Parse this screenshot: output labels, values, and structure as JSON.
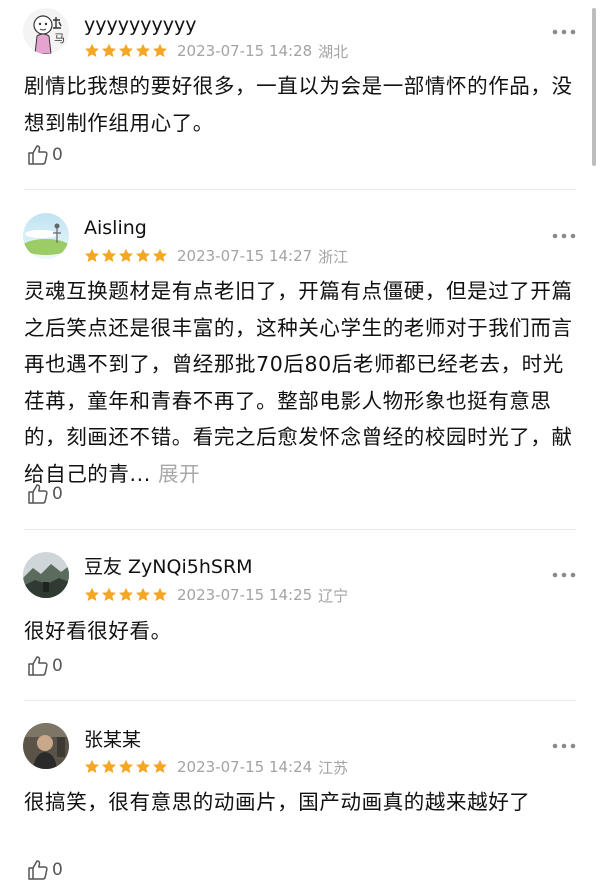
{
  "colors": {
    "star": "#f5a623",
    "meta_text": "#a3a3a3",
    "expand_text": "#a8a8a8",
    "divider": "#e9e9e9"
  },
  "comments": [
    {
      "username": "yyyyyyyyyy",
      "rating": 5,
      "datetime": "2023-07-15 14:28",
      "location": "湖北",
      "text": "剧情比我想的要好很多，一直以为会是一部情怀的作品，没想到制作组用心了。",
      "likes": "0",
      "avatar_icon": "cartoon-avatar-icon"
    },
    {
      "username": "Aisling",
      "rating": 5,
      "datetime": "2023-07-15 14:27",
      "location": "浙江",
      "text": "灵魂互换题材是有点老旧了，开篇有点僵硬，但是过了开篇之后笑点还是很丰富的，这种关心学生的老师对于我们而言再也遇不到了，曾经那批70后80后老师都已经老去，时光荏苒，童年和青春不再了。整部电影人物形象也挺有意思的，刻画还不错。看完之后愈发怀念曾经的校园时光了，献给自己的青...",
      "expand_label": "展开",
      "likes": "0",
      "avatar_icon": "sky-avatar-icon"
    },
    {
      "username": "豆友 ZyNQi5hSRM",
      "rating": 5,
      "datetime": "2023-07-15 14:25",
      "location": "辽宁",
      "text": "很好看很好看。",
      "likes": "0",
      "avatar_icon": "landscape-avatar-icon"
    },
    {
      "username": "张某某",
      "rating": 5,
      "datetime": "2023-07-15 14:24",
      "location": "江苏",
      "text": "很搞笑，很有意思的动画片，国产动画真的越来越好了",
      "likes": "0",
      "avatar_icon": "photo-avatar-icon"
    }
  ]
}
